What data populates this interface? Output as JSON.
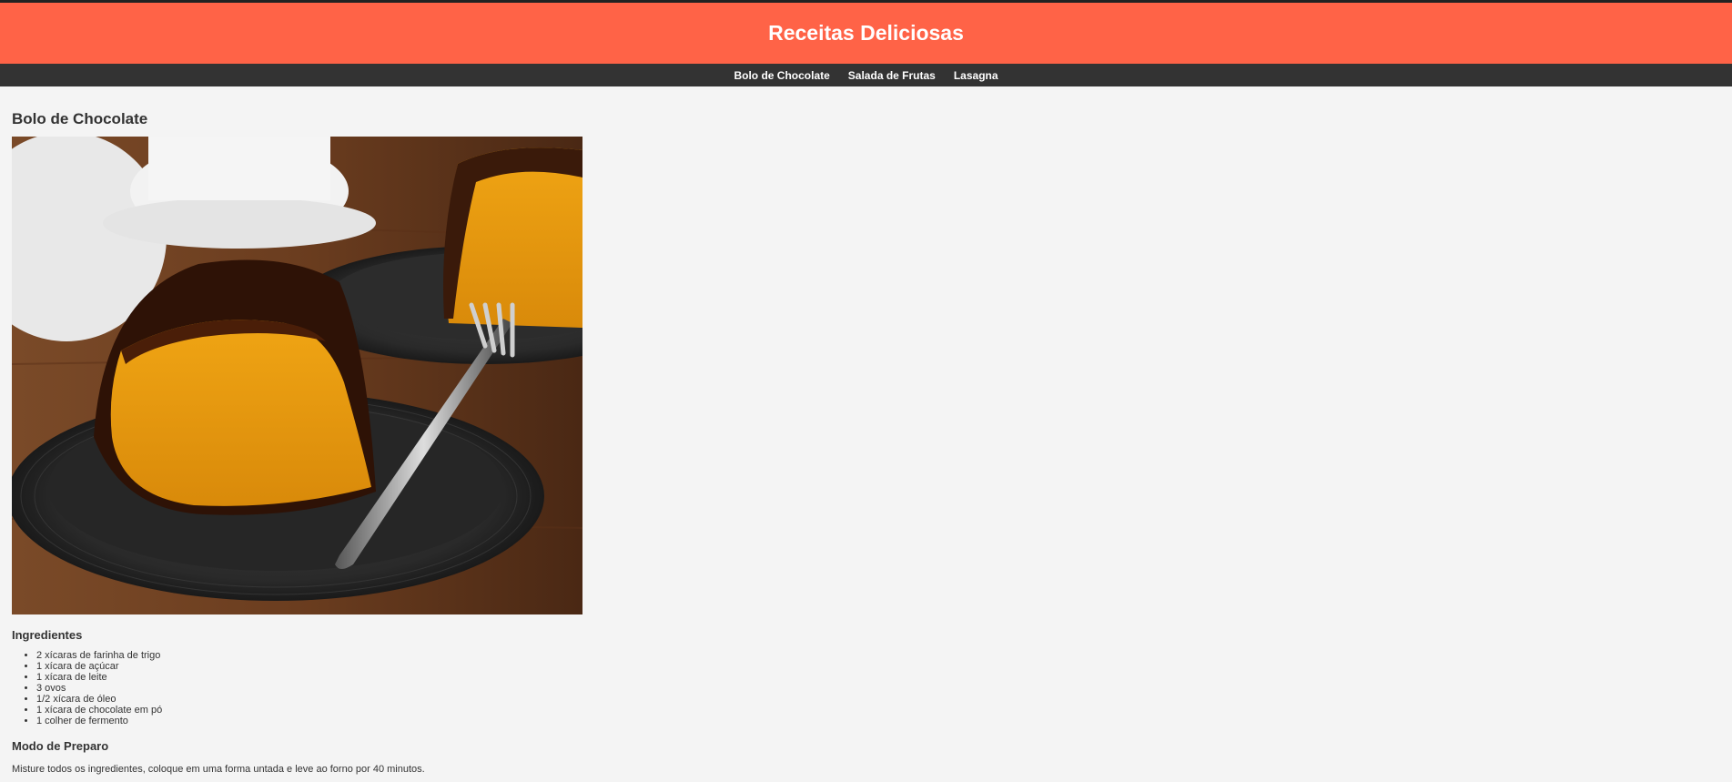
{
  "header": {
    "title": "Receitas Deliciosas"
  },
  "nav": {
    "items": [
      {
        "label": "Bolo de Chocolate"
      },
      {
        "label": "Salada de Frutas"
      },
      {
        "label": "Lasagna"
      }
    ]
  },
  "recipe": {
    "title": "Bolo de Chocolate",
    "ingredients_heading": "Ingredientes",
    "ingredients": [
      "2 xícaras de farinha de trigo",
      "1 xícara de açúcar",
      "1 xícara de leite",
      "3 ovos",
      "1/2 xícara de óleo",
      "1 xícara de chocolate em pó",
      "1 colher de fermento"
    ],
    "method_heading": "Modo de Preparo",
    "method_text": "Misture todos os ingredientes, coloque em uma forma untada e leve ao forno por 40 minutos."
  },
  "colors": {
    "header_bg": "#ff6347",
    "nav_bg": "#333333",
    "page_bg": "#f4f4f4"
  }
}
